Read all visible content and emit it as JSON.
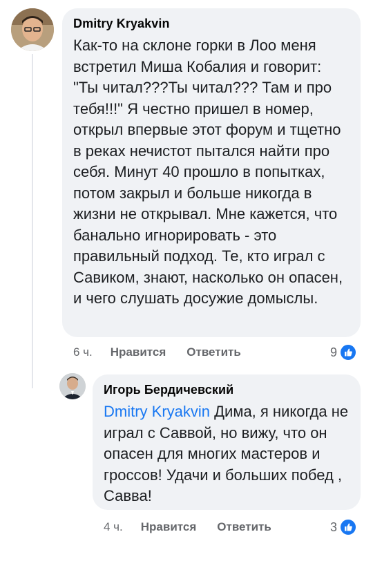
{
  "comments": [
    {
      "author": "Dmitry Kryakvin",
      "text": "Как-то на склоне горки в Лоо меня встретил Миша Кобалия и говорит: \"Ты читал???Ты читал??? Там и про тебя!!!\" Я честно пришел в номер, открыл впервые этот форум и тщетно в реках нечистот пытался найти про себя. Минут 40 прошло в попытках, потом закрыл и больше никогда в жизни не открывал. Мне кажется, что банально игнорировать - это правильный подход. Те, кто играл с Савиком, знают, насколько он опасен, и чего слушать досужие домыслы.",
      "time": "6 ч.",
      "like_label": "Нравится",
      "reply_label": "Ответить",
      "reaction_count": "9",
      "reaction_icon": "like-icon"
    },
    {
      "author": "Игорь Бердичевский",
      "mention": "Dmitry Kryakvin",
      "text": " Дима, я никогда не играл с Саввой, но вижу, что он опасен для многих мастеров и гроссов! Удачи и больших побед , Савва!",
      "time": "4 ч.",
      "like_label": "Нравится",
      "reply_label": "Ответить",
      "reaction_count": "3",
      "reaction_icon": "like-icon"
    }
  ],
  "colors": {
    "bubble": "#f0f2f5",
    "mention": "#1877f2",
    "meta": "#65676b",
    "like": "#1877f2"
  }
}
